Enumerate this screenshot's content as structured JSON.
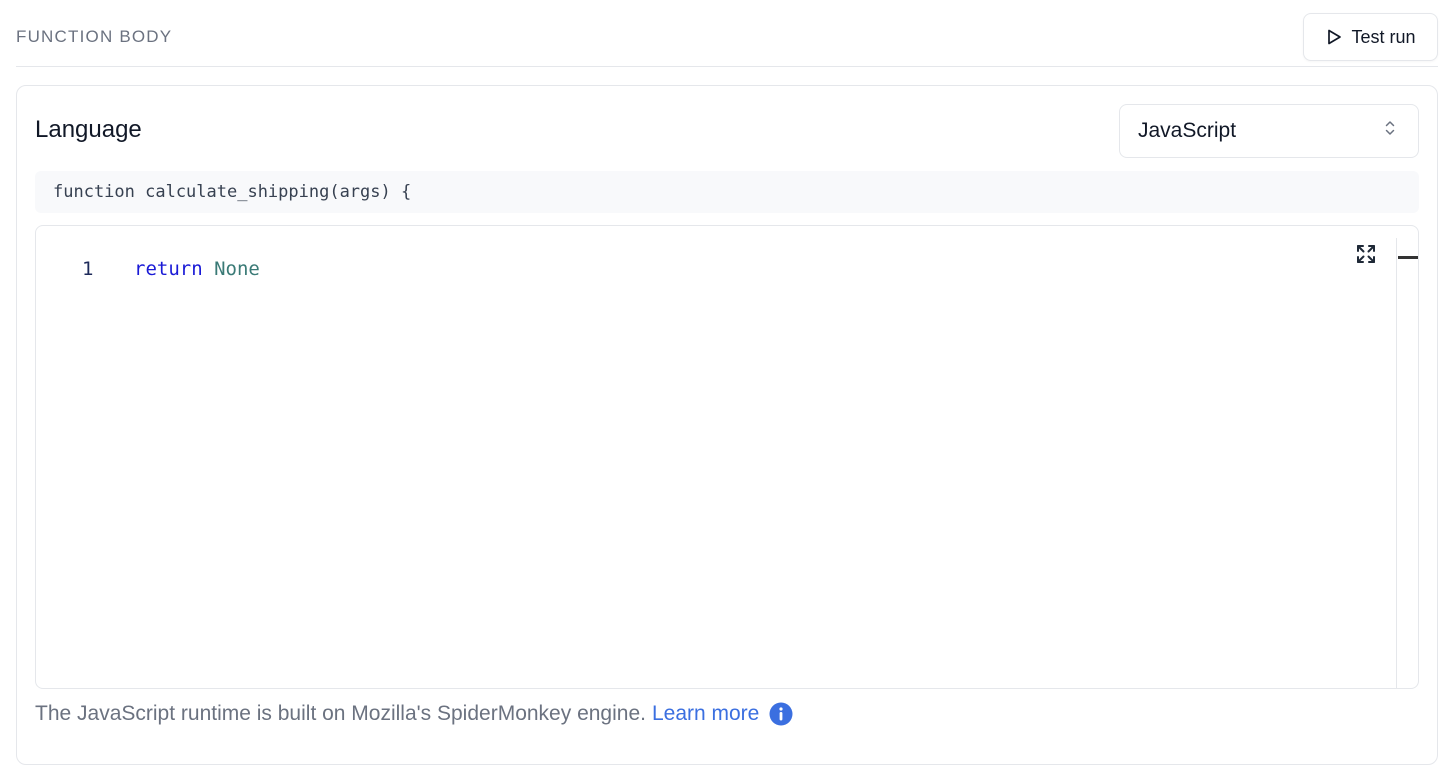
{
  "header": {
    "section_title": "FUNCTION BODY",
    "test_run_label": "Test run"
  },
  "card": {
    "language_label": "Language",
    "language_select": {
      "selected": "JavaScript"
    },
    "signature": "function calculate_shipping(args) {",
    "editor": {
      "lines": [
        {
          "number": "1",
          "keyword": "return",
          "value": "None"
        }
      ]
    }
  },
  "footer": {
    "note": "The JavaScript runtime is built on Mozilla's SpiderMonkey engine.",
    "link_label": "Learn more"
  },
  "colors": {
    "accent": "#3b6fe0",
    "keyword": "#1a1ad6",
    "constant": "#3a7a76",
    "muted_text": "#6b7280"
  },
  "icons": {
    "test_run": "play-icon",
    "select": "chevron-up-down-icon",
    "expand": "expand-icon",
    "info": "info-icon"
  }
}
